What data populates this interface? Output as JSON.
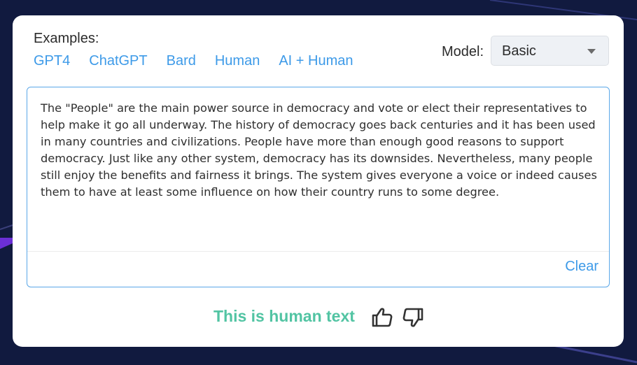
{
  "examples": {
    "label": "Examples:",
    "links": [
      "GPT4",
      "ChatGPT",
      "Bard",
      "Human",
      "AI + Human"
    ]
  },
  "model": {
    "label": "Model:",
    "selected": "Basic"
  },
  "input": {
    "text": "The \"People\" are the main power source in democracy and vote or elect their representatives to help make it go all underway. The history of democracy goes back centuries and it has been used in many countries and civilizations. People have more than enough good reasons to support democracy. Just like any other system, democracy has its downsides. Nevertheless, many people still enjoy the benefits and fairness it brings. The system gives everyone a voice or indeed causes them to have at least some influence on how their country runs to some degree.",
    "clear_label": "Clear"
  },
  "result": {
    "text": "This is human text"
  },
  "feedback": {
    "up_icon": "thumbs-up-icon",
    "down_icon": "thumbs-down-icon"
  },
  "colors": {
    "background": "#111a3f",
    "link": "#3d9ae8",
    "result": "#52c4a3",
    "card": "#ffffff"
  }
}
